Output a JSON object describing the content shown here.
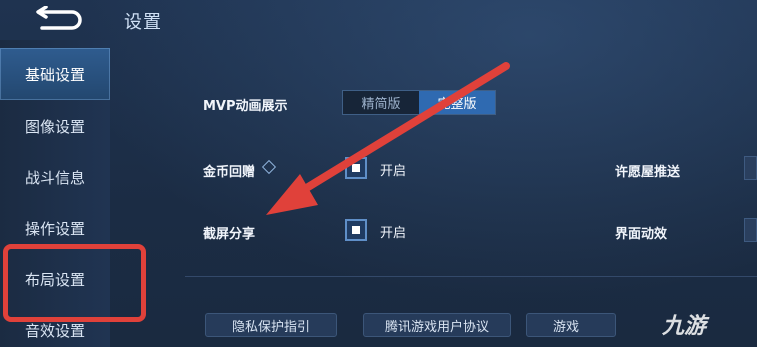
{
  "header": {
    "title": "设置"
  },
  "sidebar": {
    "items": [
      {
        "label": "基础设置"
      },
      {
        "label": "图像设置"
      },
      {
        "label": "战斗信息"
      },
      {
        "label": "操作设置"
      },
      {
        "label": "布局设置"
      },
      {
        "label": "音效设置"
      }
    ],
    "active_index": 0,
    "highlighted_index": 4
  },
  "settings": {
    "mvp_label": "MVP动画展示",
    "mvp_options": [
      "精简版",
      "完整版"
    ],
    "mvp_selected": "完整版",
    "coin_label": "金币回赠",
    "coin_value": "开启",
    "wish_label": "许愿屋推送",
    "screenshot_label": "截屏分享",
    "screenshot_value": "开启",
    "ui_anim_label": "界面动效"
  },
  "footer_buttons": [
    "隐私保护指引",
    "腾讯游戏用户协议",
    "游戏"
  ],
  "watermark": "九游",
  "colors": {
    "annotation": "#e0413a",
    "accent": "#2f6ab1"
  },
  "icons": [
    "back-arrow-icon",
    "checkbox-icon",
    "info-diamond-icon",
    "annotation-arrow"
  ]
}
